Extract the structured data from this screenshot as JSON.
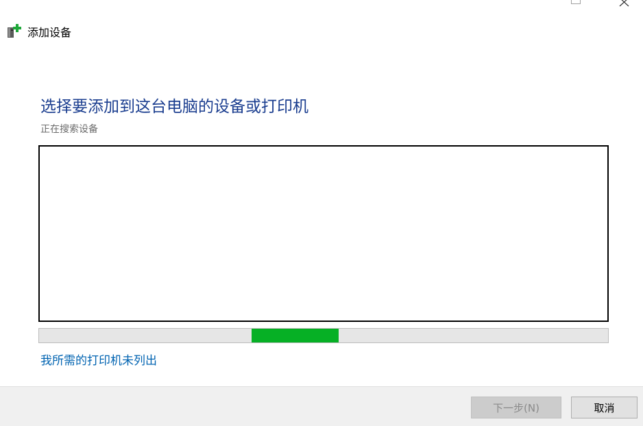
{
  "window": {
    "title": "添加设备"
  },
  "main": {
    "heading": "选择要添加到这台电脑的设备或打印机",
    "status": "正在搜索设备",
    "progress": {
      "fill_start_fraction": 0.373,
      "fill_width_fraction": 0.153,
      "color": "#06b025"
    },
    "printer_not_listed_link": "我所需的打印机未列出"
  },
  "footer": {
    "next_label": "下一步(N)",
    "cancel_label": "取消"
  },
  "colors": {
    "heading": "#1a3d8f",
    "link": "#0063b1",
    "footer_bg": "#f0f0f0"
  }
}
